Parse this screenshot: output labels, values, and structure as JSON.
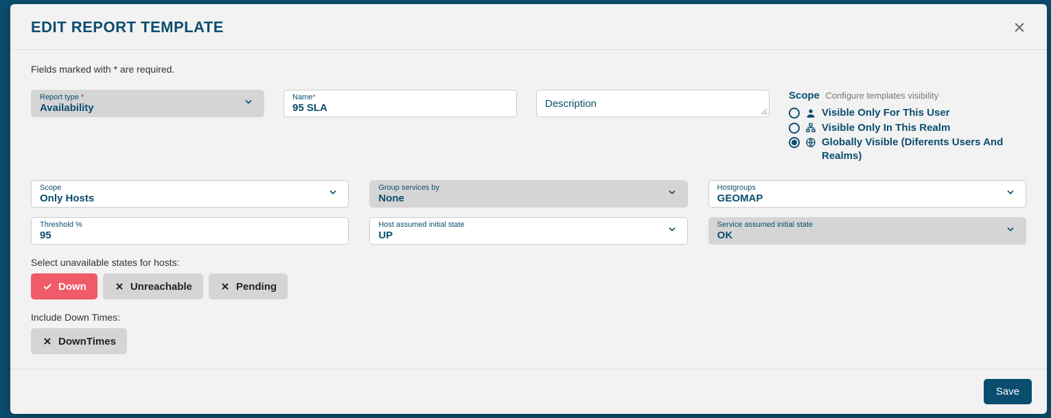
{
  "modal": {
    "title": "EDIT REPORT TEMPLATE",
    "required_note": "Fields marked with * are required."
  },
  "fields": {
    "report_type": {
      "label": "Report type ",
      "value": "Availability"
    },
    "name": {
      "label": "Name",
      "value": "95 SLA"
    },
    "description": {
      "placeholder": "Description"
    },
    "scope_select": {
      "label": "Scope",
      "value": "Only Hosts"
    },
    "group_services_by": {
      "label": "Group services by",
      "value": "None"
    },
    "hostgroups": {
      "label": "Hostgroups",
      "value": "GEOMAP"
    },
    "threshold": {
      "label": "Threshold %",
      "value": "95"
    },
    "host_initial": {
      "label": "Host assumed initial state",
      "value": "UP"
    },
    "service_initial": {
      "label": "Service assumed initial state",
      "value": "OK"
    }
  },
  "scope": {
    "heading": "Scope",
    "sub": "Configure templates visibility",
    "options": [
      {
        "label": "Visible Only For This User",
        "icon": "user",
        "selected": false
      },
      {
        "label": "Visible Only In This Realm",
        "icon": "tree",
        "selected": false
      },
      {
        "label": "Globally Visible (Diferents Users And Realms)",
        "icon": "globe",
        "selected": true
      }
    ]
  },
  "unavailable_states": {
    "label": "Select unavailable states for hosts:",
    "chips": [
      {
        "label": "Down",
        "active": true
      },
      {
        "label": "Unreachable",
        "active": false
      },
      {
        "label": "Pending",
        "active": false
      }
    ]
  },
  "downtimes": {
    "label": "Include Down Times:",
    "chip": {
      "label": "DownTimes",
      "active": false
    }
  },
  "footer": {
    "save": "Save"
  }
}
